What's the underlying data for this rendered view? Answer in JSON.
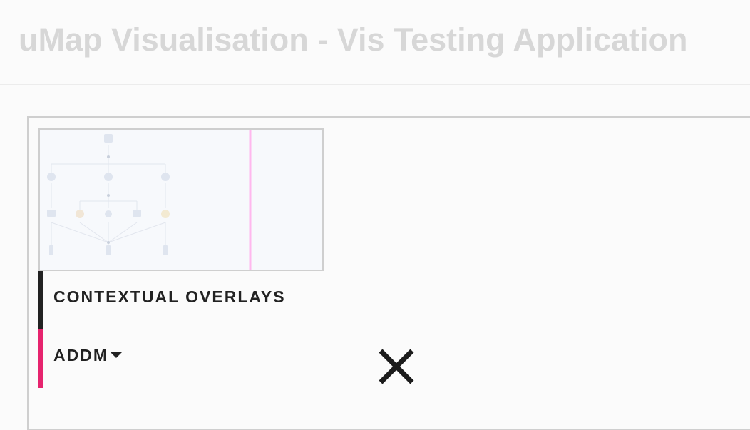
{
  "header": {
    "title": "uMap Visualisation - Vis Testing Application"
  },
  "overlays": {
    "contextual_label": "CONTEXTUAL OVERLAYS",
    "addm_label": "ADDM",
    "addm_color": "#e6246e",
    "contextual_color": "#222222"
  },
  "icons": {
    "dropdown": "caret-down-icon",
    "close": "close-icon"
  }
}
